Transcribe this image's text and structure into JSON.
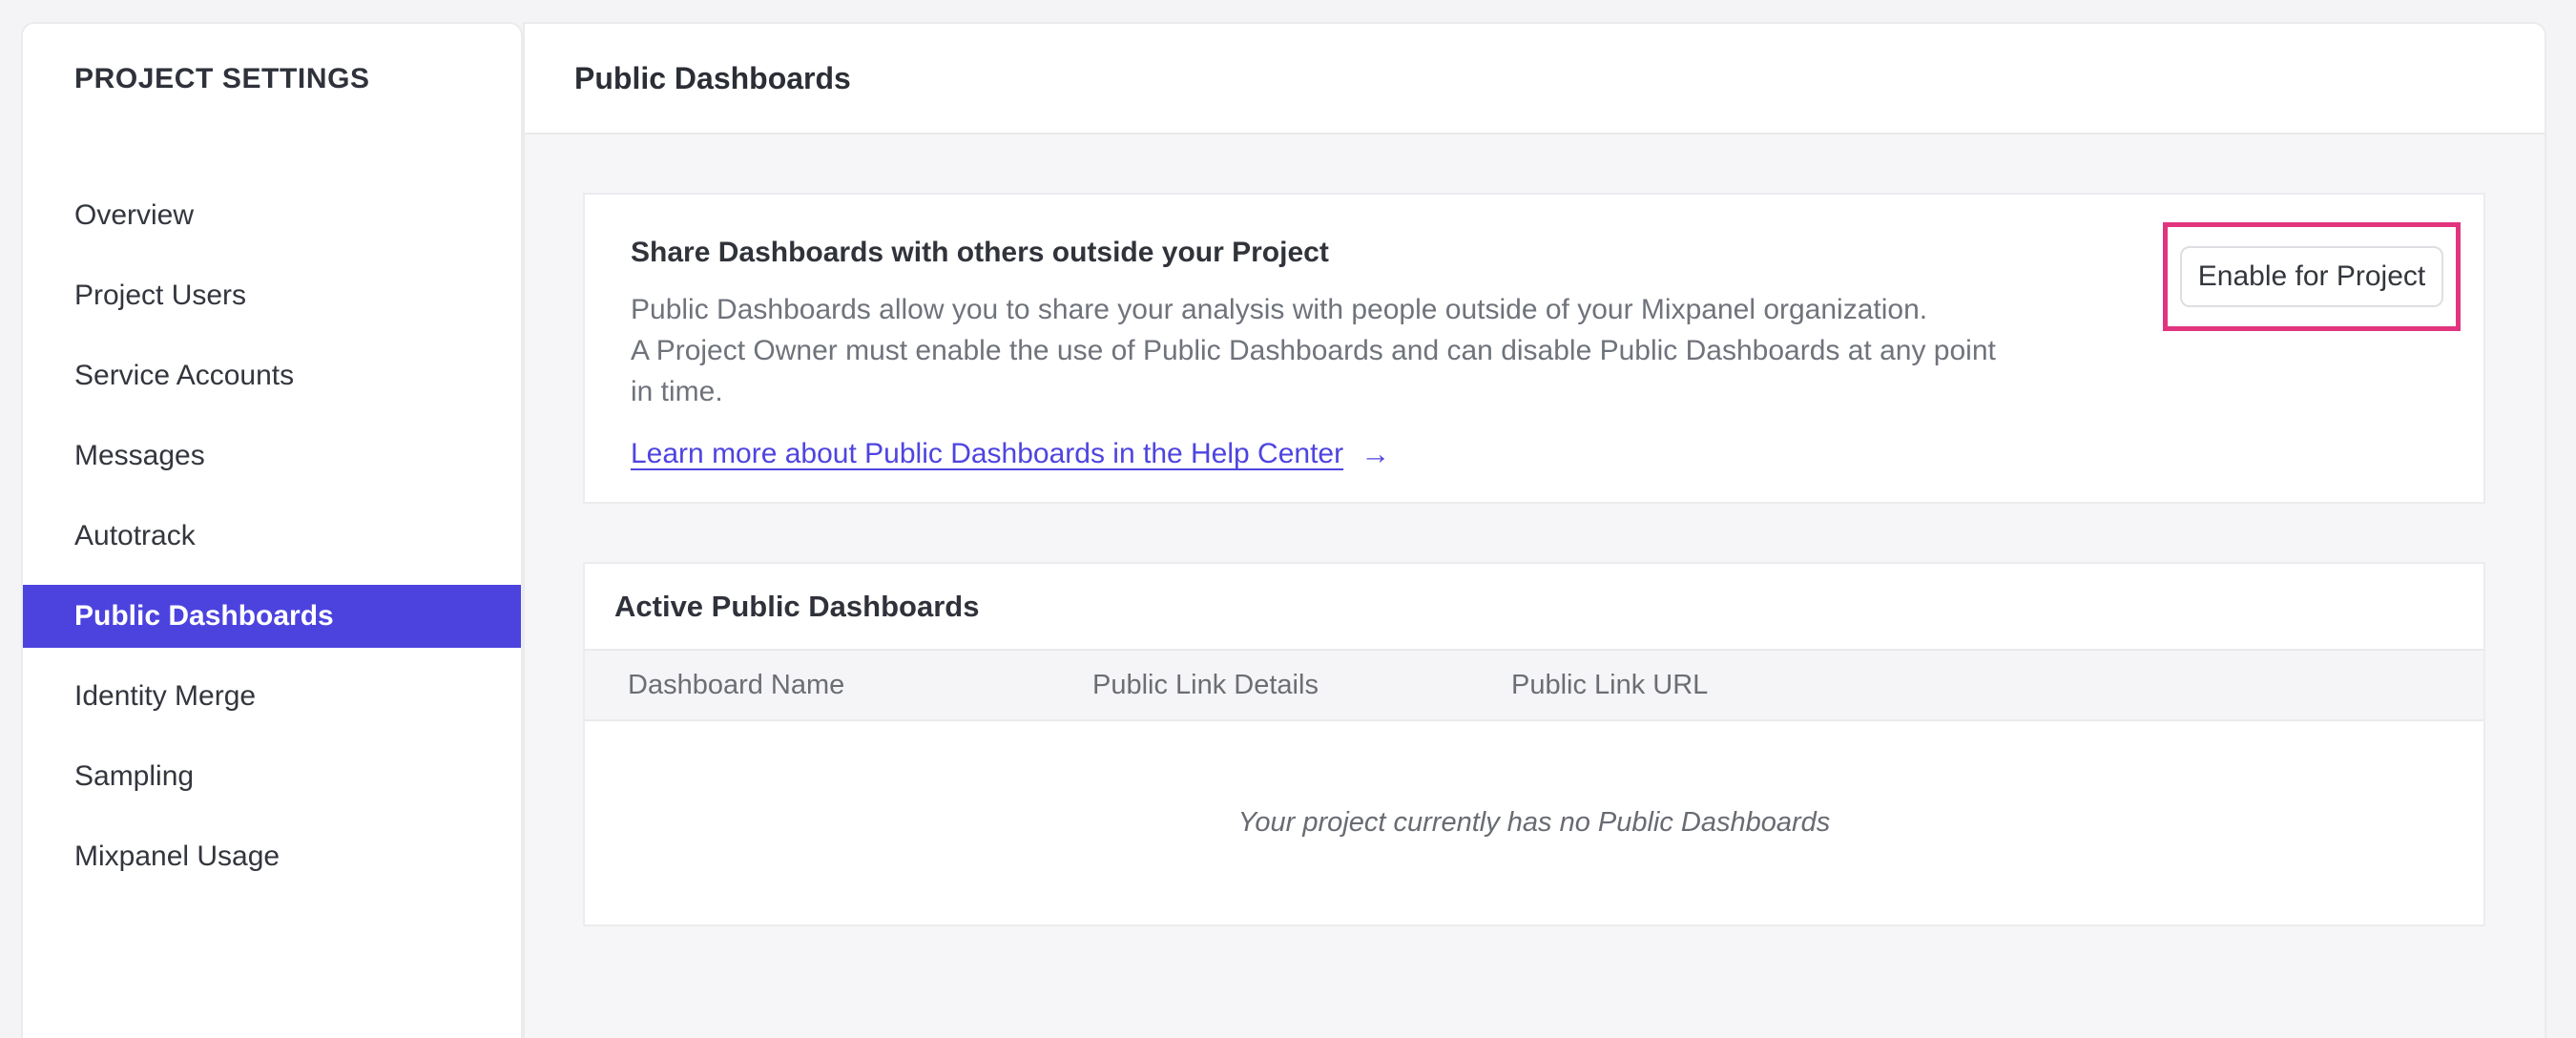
{
  "sidebar": {
    "title": "PROJECT SETTINGS",
    "items": [
      {
        "label": "Overview",
        "selected": false
      },
      {
        "label": "Project Users",
        "selected": false
      },
      {
        "label": "Service Accounts",
        "selected": false
      },
      {
        "label": "Messages",
        "selected": false
      },
      {
        "label": "Autotrack",
        "selected": false
      },
      {
        "label": "Public Dashboards",
        "selected": true
      },
      {
        "label": "Identity Merge",
        "selected": false
      },
      {
        "label": "Sampling",
        "selected": false
      },
      {
        "label": "Mixpanel Usage",
        "selected": false
      }
    ]
  },
  "header": {
    "title": "Public Dashboards"
  },
  "share_card": {
    "heading": "Share Dashboards with others outside your Project",
    "body_lines": [
      "Public Dashboards allow you to share your analysis with people outside of your Mixpanel organization.",
      "A Project Owner must enable the use of Public Dashboards and can disable Public Dashboards at any point",
      "in time."
    ],
    "link_label": "Learn more about Public Dashboards in the Help Center",
    "link_arrow": "→",
    "enable_button_label": "Enable for Project"
  },
  "active_card": {
    "heading": "Active Public Dashboards",
    "columns": [
      "Dashboard Name",
      "Public Link Details",
      "Public Link URL"
    ],
    "empty_message": "Your project currently has no Public Dashboards"
  },
  "colors": {
    "selected_nav_background": "#4C43DF",
    "link_purple": "#4E44E0",
    "annotation_pink": "#E2347E"
  }
}
